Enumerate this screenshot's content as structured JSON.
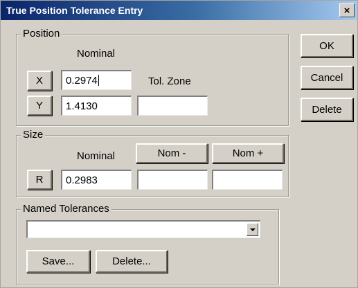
{
  "window": {
    "title": "True Position Tolerance Entry",
    "close_label": "×"
  },
  "position": {
    "legend": "Position",
    "nominal_label": "Nominal",
    "tol_zone_label": "Tol. Zone",
    "x_button": "X",
    "x_value": "0.2974",
    "y_button": "Y",
    "y_value": "1.4130",
    "tol_zone_value": ""
  },
  "size": {
    "legend": "Size",
    "nominal_label": "Nominal",
    "nom_minus_button": "Nom -",
    "nom_plus_button": "Nom +",
    "r_button": "R",
    "r_value": "0.2983",
    "nom_minus_value": "",
    "nom_plus_value": ""
  },
  "named_tolerances": {
    "legend": "Named Tolerances",
    "selected": "",
    "save_button": "Save...",
    "delete_button": "Delete..."
  },
  "actions": {
    "ok": "OK",
    "cancel": "Cancel",
    "delete": "Delete"
  }
}
